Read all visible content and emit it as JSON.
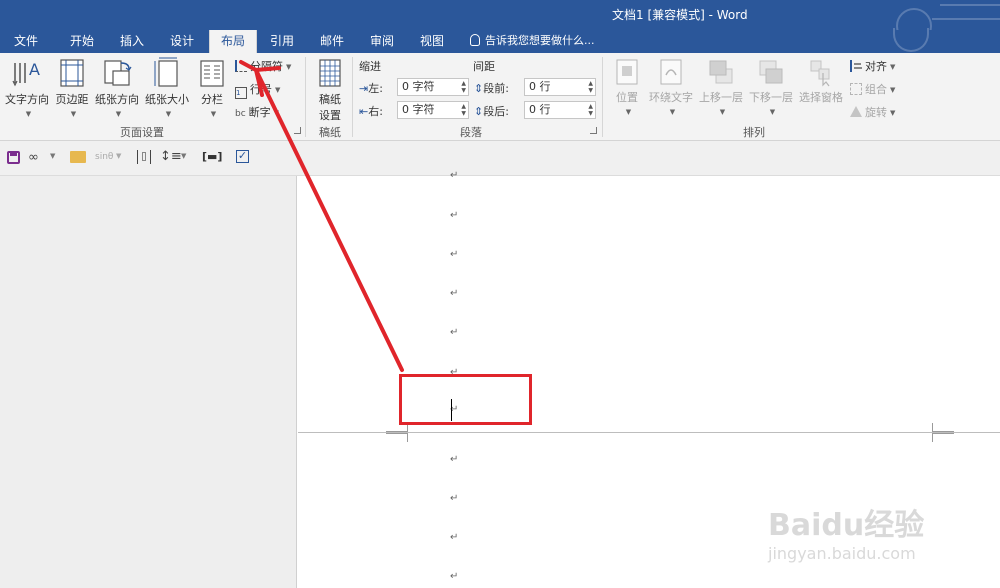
{
  "window": {
    "title": "文档1 [兼容模式] - Word"
  },
  "tabs": [
    {
      "label": "文件",
      "active": false
    },
    {
      "label": "开始",
      "active": false
    },
    {
      "label": "插入",
      "active": false
    },
    {
      "label": "设计",
      "active": false
    },
    {
      "label": "布局",
      "active": true
    },
    {
      "label": "引用",
      "active": false
    },
    {
      "label": "邮件",
      "active": false
    },
    {
      "label": "审阅",
      "active": false
    },
    {
      "label": "视图",
      "active": false
    }
  ],
  "tell_me": "告诉我您想要做什么...",
  "ribbon": {
    "page_setup": {
      "label": "页面设置",
      "text_direction": "文字方向",
      "margins": "页边距",
      "orientation": "纸张方向",
      "size": "纸张大小",
      "columns": "分栏",
      "breaks": "分隔符",
      "line_numbers": "行号",
      "hyphenation": "断字"
    },
    "draft": {
      "label": "稿纸",
      "button": "稿纸\n设置",
      "button_line1": "稿纸",
      "button_line2": "设置"
    },
    "paragraph": {
      "label": "段落",
      "indent_header": "缩进",
      "spacing_header": "间距",
      "left_label": "左:",
      "right_label": "右:",
      "before_label": "段前:",
      "after_label": "段后:",
      "left_value": "0 字符",
      "right_value": "0 字符",
      "before_value": "0 行",
      "after_value": "0 行"
    },
    "arrange": {
      "label": "排列",
      "position": "位置",
      "wrap_text": "环绕文字",
      "bring_forward": "上移一层",
      "send_backward": "下移一层",
      "selection_pane": "选择窗格",
      "align": "对齐",
      "group": "组合",
      "rotate": "旋转"
    }
  },
  "quick_toolbar": {
    "sin_label": "sinθ"
  },
  "document": {
    "paragraph_mark": "↵"
  },
  "watermark": {
    "brand": "Baidu经验",
    "url": "jingyan.baidu.com"
  },
  "colors": {
    "title_bar": "#2b579a",
    "ribbon": "#f3f3f3",
    "annotation": "#e0252b"
  }
}
